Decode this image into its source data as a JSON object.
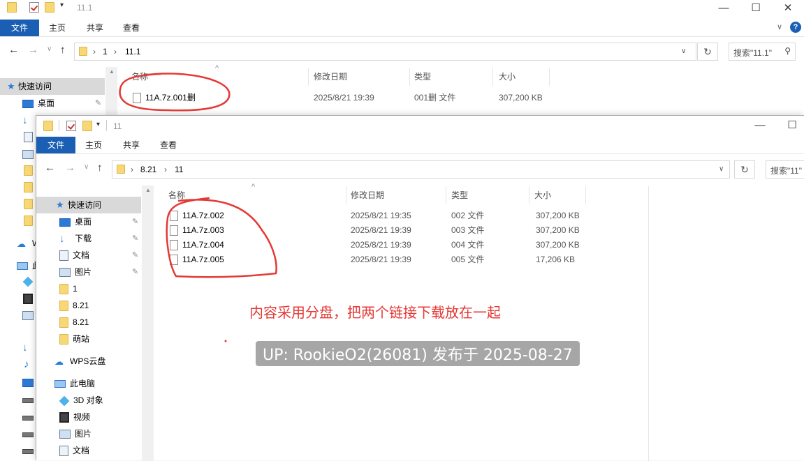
{
  "back_window": {
    "title": "11.1",
    "controls": {
      "minimize": "—",
      "maximize": "☐",
      "close": "✕"
    },
    "ribbon": {
      "file": "文件",
      "home": "主页",
      "share": "共享",
      "view": "查看"
    },
    "breadcrumb": [
      "1",
      "11.1"
    ],
    "search_placeholder": "搜索\"11.1\"",
    "columns": {
      "name": "名称",
      "date": "修改日期",
      "type": "类型",
      "size": "大小"
    },
    "sidebar": {
      "quick_access": "快速访问",
      "desktop": "桌面",
      "wps": "W",
      "pc": "此"
    },
    "files": [
      {
        "name": "11A.7z.001删",
        "date": "2025/8/21 19:39",
        "type": "001删 文件",
        "size": "307,200 KB"
      }
    ]
  },
  "front_window": {
    "title": "11",
    "controls": {
      "minimize": "—",
      "maximize": "☐"
    },
    "ribbon": {
      "file": "文件",
      "home": "主页",
      "share": "共享",
      "view": "查看"
    },
    "breadcrumb": [
      "8.21",
      "11"
    ],
    "search_placeholder": "搜索\"11\"",
    "columns": {
      "name": "名称",
      "date": "修改日期",
      "type": "类型",
      "size": "大小"
    },
    "sidebar": {
      "quick_access": "快速访问",
      "desktop": "桌面",
      "downloads": "下载",
      "documents": "文档",
      "pictures": "图片",
      "f1": "1",
      "f2": "8.21",
      "f3": "8.21",
      "f4": "萌站",
      "wps": "WPS云盘",
      "pc": "此电脑",
      "obj3d": "3D 对象",
      "videos": "视频",
      "pictures2": "图片",
      "documents2": "文档"
    },
    "files": [
      {
        "name": "11A.7z.002",
        "date": "2025/8/21 19:35",
        "type": "002 文件",
        "size": "307,200 KB"
      },
      {
        "name": "11A.7z.003",
        "date": "2025/8/21 19:39",
        "type": "003 文件",
        "size": "307,200 KB"
      },
      {
        "name": "11A.7z.004",
        "date": "2025/8/21 19:39",
        "type": "004 文件",
        "size": "307,200 KB"
      },
      {
        "name": "11A.7z.005",
        "date": "2025/8/21 19:39",
        "type": "005 文件",
        "size": "17,206 KB"
      }
    ]
  },
  "annotation": "内容采用分盘，把两个链接下载放在一起",
  "watermark": "UP: RookieO2(26081) 发布于 2025-08-27",
  "colors": {
    "accent": "#1a5fb4",
    "annotation": "#e53935",
    "folder": "#f8d775"
  }
}
